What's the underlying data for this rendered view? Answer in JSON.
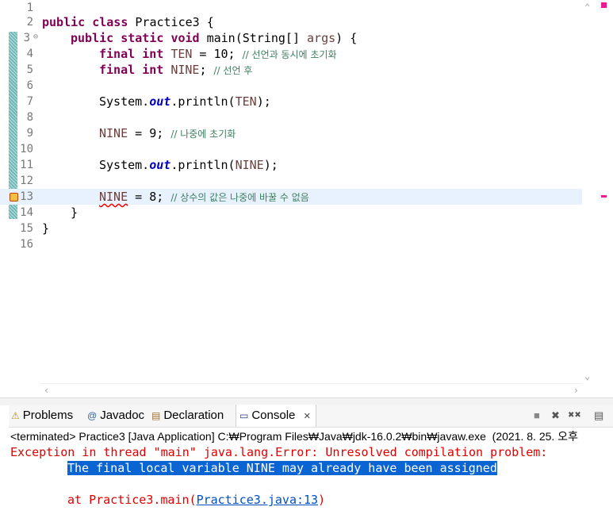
{
  "editor": {
    "line_numbers": [
      "1",
      "2",
      "3",
      "4",
      "5",
      "6",
      "7",
      "8",
      "9",
      "10",
      "11",
      "12",
      "13",
      "14",
      "15",
      "16"
    ],
    "lines": {
      "l2": {
        "kw1": "public",
        "kw2": "class",
        "rest": " Practice3 {"
      },
      "l3": {
        "kw1": "public",
        "kw2": "static",
        "kw3": "void",
        "rest": " main(String[] ",
        "arg": "args",
        "end": ") {"
      },
      "l4": {
        "kw1": "final",
        "kw2": "int",
        "var": "TEN",
        "mid": " = 10; ",
        "comment": "// 선언과 동시에 초기화"
      },
      "l5": {
        "kw1": "final",
        "kw2": "int",
        "var": "NINE",
        "mid": "; ",
        "comment": "// 선언 후"
      },
      "l7": {
        "pre": "System.",
        "field": "out",
        "post": ".println(",
        "var": "TEN",
        "end": ");"
      },
      "l9": {
        "var": "NINE",
        "mid": " = 9; ",
        "comment": "// 나중에 초기화"
      },
      "l11": {
        "pre": "System.",
        "field": "out",
        "post": ".println(",
        "var": "NINE",
        "end": ");"
      },
      "l13": {
        "var": "NINE",
        "mid": " = 8; ",
        "comment": "// 상수의 값은 나중에 바꿀 수 없음"
      },
      "l14": {
        "text": "}"
      },
      "l15": {
        "text": "}"
      }
    },
    "fold_marker": "⊖"
  },
  "scrollbars": {
    "up": "⌃",
    "down": "⌄",
    "left": "‹",
    "right": "›"
  },
  "tabs": [
    {
      "label": "Problems",
      "icon": "problems-icon",
      "glyph": "⚠"
    },
    {
      "label": "Javadoc",
      "icon": "javadoc-icon",
      "glyph": "@"
    },
    {
      "label": "Declaration",
      "icon": "declaration-icon",
      "glyph": "▤"
    },
    {
      "label": "Console",
      "icon": "console-icon",
      "glyph": "▭",
      "close": "✕"
    }
  ],
  "toolbar": {
    "terminate": "■",
    "remove": "✖",
    "remove_all": "✖✖",
    "clear": "▤"
  },
  "console": {
    "status_line": "<terminated> Practice3 [Java Application] C:₩Program Files₩Java₩jdk-16.0.2₩bin₩javaw.exe  (2021. 8. 25. 오후",
    "error_line1": "Exception in thread \"main\" java.lang.Error: Unresolved compilation problem: ",
    "error_line2": "The final local variable NINE may already have been assigned",
    "at_prefix": "at Practice3.main(",
    "at_link": "Practice3.java:13",
    "at_suffix": ")"
  },
  "colors": {
    "keyword": "#7f0055",
    "field": "#0000c0",
    "comment": "#3f7f5f",
    "error": "#e00000",
    "selection": "#0a64d2"
  }
}
